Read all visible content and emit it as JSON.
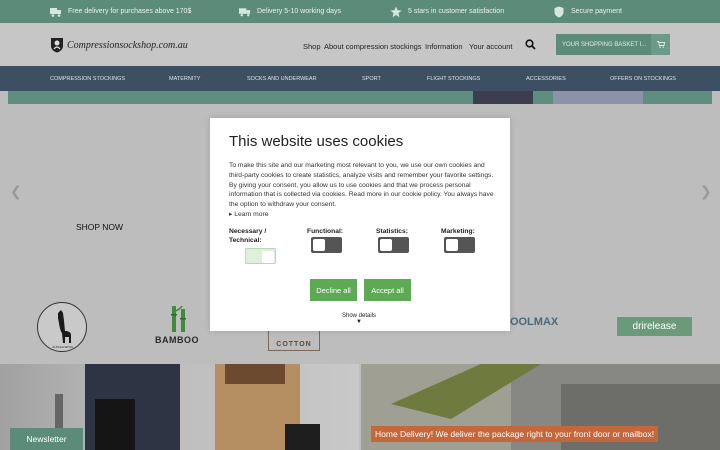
{
  "usp_bar": {
    "items": [
      {
        "text": "Free delivery for purchases above 170$",
        "icon": "truck-tick-icon"
      },
      {
        "text": "Delivery 5-10 working days",
        "icon": "truck-icon"
      },
      {
        "text": "5 stars in customer satisfaction",
        "icon": "star-icon"
      },
      {
        "text": "Secure payment",
        "icon": "shield-icon"
      }
    ]
  },
  "header": {
    "logo_text": "Compressionsockshop.com.au",
    "nav": [
      "Shop",
      "About compression stockings",
      "Information",
      "Your account"
    ],
    "basket_label": "YOUR SHOPPING BASKET I..."
  },
  "menu": {
    "items": [
      "COMPRESSION STOCKINGS",
      "MATERNITY",
      "SOCKS AND UNDERWEAR",
      "SPORT",
      "FLIGHT STOCKINGS",
      "ACCESSORIES",
      "OFFERS ON STOCKINGS"
    ]
  },
  "hero": {
    "shop_now": "SHOP NOW"
  },
  "brands": {
    "bamboo": "BAMBOO",
    "cotton": "COTTON",
    "coolmax": "COOLMAX",
    "drirelease": "drirelease",
    "alpaca": "ALPACA WOOL"
  },
  "bottom": {
    "newsletter": "Newsletter",
    "home_delivery": "Home Delivery! We deliver the package right to your front door or mailbox!"
  },
  "cookie_dialog": {
    "title": "This website uses cookies",
    "body": "To make this site and our marketing most relevant to you, we use our own cookies and third-party cookies to create statistics, analyze visits and remember your favorite settings. By giving your consent, you allow us to use cookies and that we process personal information that is collected via cookies. Read more in our cookie policy. You always have the option to withdraw your consent.",
    "learn_more": "Learn more",
    "categories": [
      {
        "label": "Necessary / Technical:",
        "enabled": true
      },
      {
        "label": "Functional:",
        "enabled": false
      },
      {
        "label": "Statistics:",
        "enabled": false
      },
      {
        "label": "Marketing:",
        "enabled": false
      }
    ],
    "decline_label": "Decline all",
    "accept_label": "Accept all",
    "show_details": "Show details"
  },
  "colors": {
    "brand_green": "#5d8b7a",
    "menu_navy": "#3d4f62",
    "button_green": "#5eaa54",
    "promo_orange": "#c4673a"
  }
}
